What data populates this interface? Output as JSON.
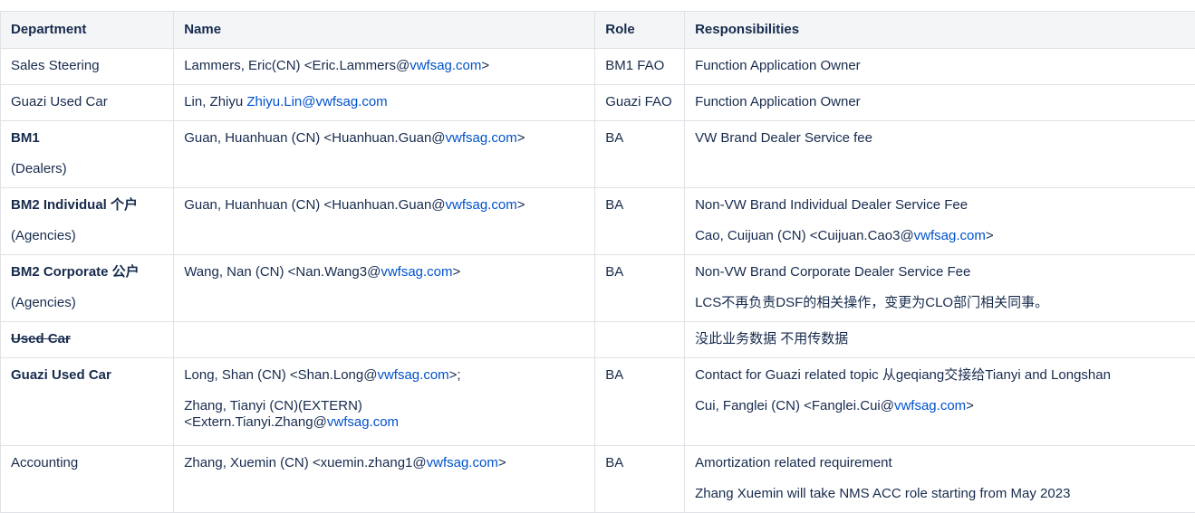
{
  "headers": {
    "department": "Department",
    "name": "Name",
    "role": "Role",
    "responsibilities": "Responsibilities"
  },
  "rows": [
    {
      "department": "Sales Steering",
      "name_prefix": "Lammers, Eric(CN) <Eric.Lammers@",
      "name_link": "vwfsag.com",
      "name_suffix": ">",
      "role": "BM1 FAO",
      "resp1": "Function Application Owner"
    },
    {
      "department": "Guazi Used Car",
      "name_prefix": "Lin, Zhiyu ",
      "name_link": "Zhiyu.Lin@vwfsag.com",
      "role": "Guazi FAO",
      "resp1": "Function Application Owner"
    },
    {
      "department": "BM1",
      "department_sub": "(Dealers)",
      "name_prefix": "Guan, Huanhuan (CN) <Huanhuan.Guan@",
      "name_link": "vwfsag.com",
      "name_suffix": ">",
      "role": "BA",
      "resp1": "VW Brand Dealer Service fee"
    },
    {
      "department": "BM2 Individual 个户",
      "department_sub": "(Agencies)",
      "name_prefix": "Guan, Huanhuan (CN) <Huanhuan.Guan@",
      "name_link": "vwfsag.com",
      "name_suffix": ">",
      "role": "BA",
      "resp1": "Non-VW Brand Individual Dealer Service Fee",
      "resp2_prefix": "Cao, Cuijuan (CN) <Cuijuan.Cao3@",
      "resp2_link": "vwfsag.com",
      "resp2_suffix": ">"
    },
    {
      "department": "BM2 Corporate 公户",
      "department_sub": "(Agencies)",
      "name_prefix": "Wang, Nan (CN) <Nan.Wang3@",
      "name_link": "vwfsag.com",
      "name_suffix": ">",
      "role": "BA",
      "resp1": "Non-VW Brand Corporate Dealer Service Fee",
      "resp2": "LCS不再负责DSF的相关操作，变更为CLO部门相关同事。"
    },
    {
      "department": "Used Car",
      "resp1": "没此业务数据 不用传数据"
    },
    {
      "department": "Guazi Used Car",
      "name_prefix": "Long, Shan (CN) <Shan.Long@",
      "name_link": "vwfsag.com",
      "name_suffix": ">;",
      "name2_line1": "Zhang, Tianyi (CN)(EXTERN)",
      "name2_prefix": "<Extern.Tianyi.Zhang@",
      "name2_link": "vwfsag.com",
      "role": "BA",
      "resp1": "Contact for Guazi related topic 从geqiang交接给Tianyi and Longshan",
      "resp2_prefix": "Cui, Fanglei (CN) <Fanglei.Cui@",
      "resp2_link": "vwfsag.com",
      "resp2_suffix": ">"
    },
    {
      "department": "Accounting",
      "name_prefix": "Zhang, Xuemin (CN) <xuemin.zhang1@",
      "name_link": "vwfsag.com",
      "name_suffix": ">",
      "role": "BA",
      "resp1": "Amortization related requirement",
      "resp2": "Zhang Xuemin will take NMS ACC role starting from May 2023"
    }
  ],
  "colors": {
    "link": "#0052cc",
    "header_bg": "#f4f5f7",
    "border": "#dfe1e6",
    "text": "#172b4d"
  }
}
